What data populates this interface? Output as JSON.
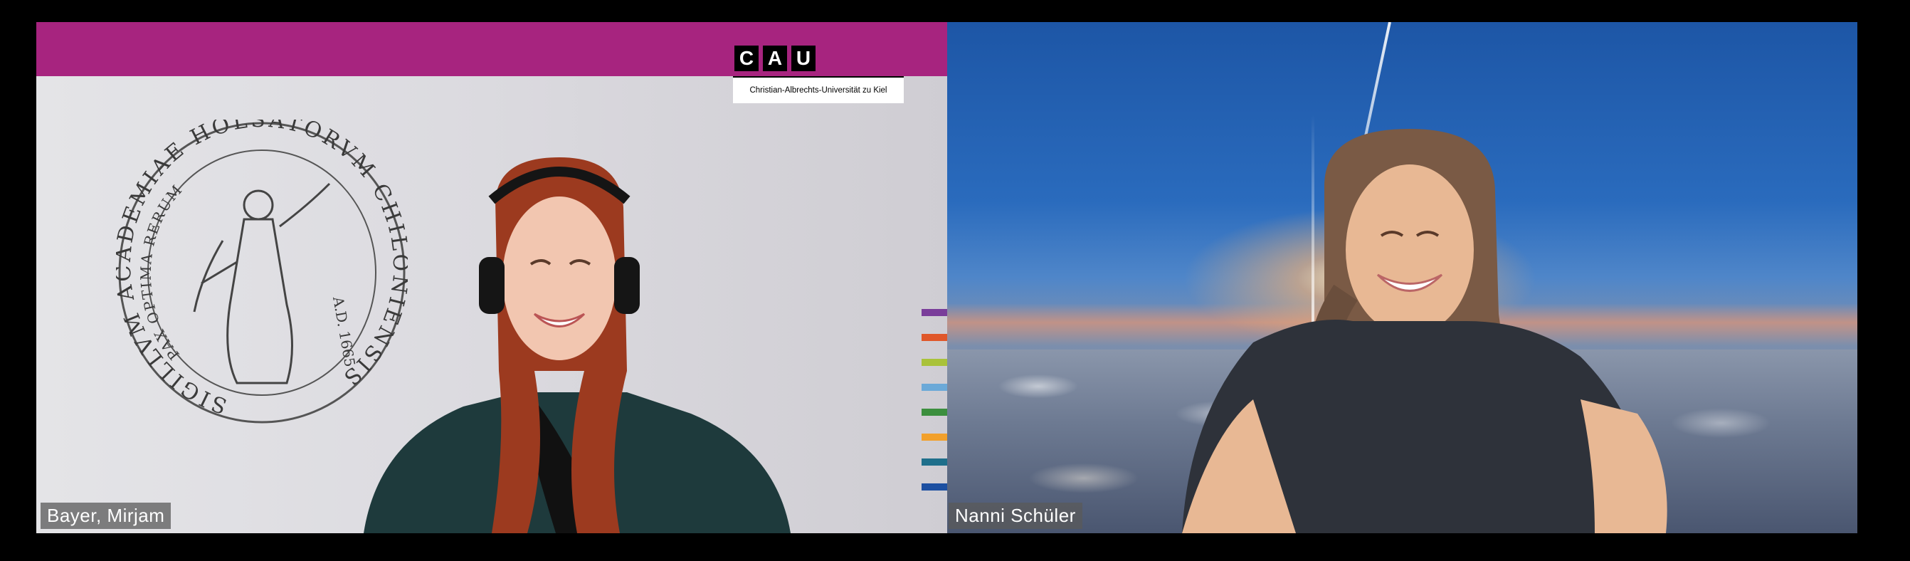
{
  "call": {
    "participants": [
      {
        "name": "Bayer, Mirjam",
        "background": {
          "brand_color": "#a7247f",
          "logo_letters": [
            "C",
            "A",
            "U"
          ],
          "logo_subtitle": "Christian-Albrechts-Universität zu Kiel",
          "seal_text_outer": "SIGILLVM ACADEMIAE HOLSATORVM CHILONIENSIS",
          "seal_text_inner": "PAX OPTIMA RERUM",
          "seal_year": "A.D. 1665",
          "stripe_colors": [
            "#7a3d9a",
            "#e0572a",
            "#a9c23a",
            "#6ba9d8",
            "#3c8f3e",
            "#f2a02b",
            "#1f6f8b",
            "#1c4fa1"
          ]
        }
      },
      {
        "name": "Nanni Schüler"
      }
    ]
  }
}
